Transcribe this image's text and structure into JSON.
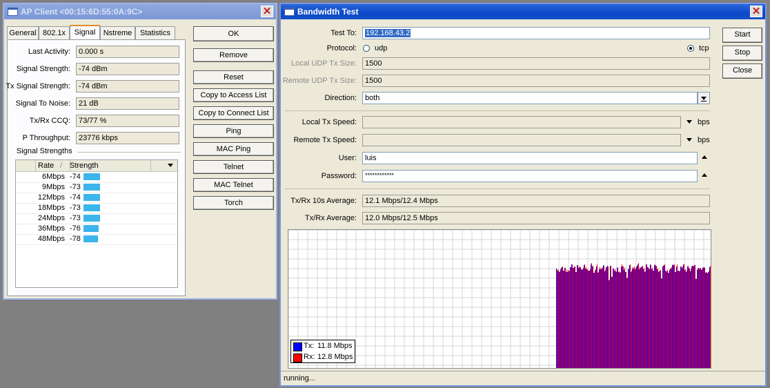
{
  "ap_client": {
    "title": "AP Client <00:15:6D:55:0A:9C>",
    "tabs": [
      "General",
      "802.1x",
      "Signal",
      "Nstreme",
      "Statistics"
    ],
    "active_tab": "Signal",
    "fields": [
      {
        "label": "Last Activity:",
        "value": "0.000 s"
      },
      {
        "label": "Signal Strength:",
        "value": "-74 dBm"
      },
      {
        "label": "Tx Signal Strength:",
        "value": "-74 dBm"
      },
      {
        "label": "Signal To Noise:",
        "value": "21 dB"
      },
      {
        "label": "Tx/Rx CCQ:",
        "value": "73/77 %"
      },
      {
        "label": "P Throughput:",
        "value": "23776 kbps"
      }
    ],
    "group_label": "Signal Strengths",
    "table": {
      "columns": [
        "Rate",
        "Strength"
      ],
      "sort_indicator": "/",
      "rows": [
        {
          "rate": "6Mbps",
          "strength": "-74",
          "bar_level": 0.74
        },
        {
          "rate": "9Mbps",
          "strength": "-73",
          "bar_level": 0.75
        },
        {
          "rate": "12Mbps",
          "strength": "-74",
          "bar_level": 0.74
        },
        {
          "rate": "18Mbps",
          "strength": "-73",
          "bar_level": 0.75
        },
        {
          "rate": "24Mbps",
          "strength": "-73",
          "bar_level": 0.75
        },
        {
          "rate": "36Mbps",
          "strength": "-76",
          "bar_level": 0.7
        },
        {
          "rate": "48Mbps",
          "strength": "-78",
          "bar_level": 0.65
        }
      ]
    },
    "buttons": [
      "OK",
      "Remove",
      "Reset",
      "Copy to Access List",
      "Copy to Connect List",
      "Ping",
      "MAC Ping",
      "Telnet",
      "MAC Telnet",
      "Torch"
    ]
  },
  "bandwidth_test": {
    "title": "Bandwidth Test",
    "buttons": {
      "start": "Start",
      "stop": "Stop",
      "close": "Close"
    },
    "test_to": {
      "label": "Test To:",
      "value": "192.168.43.2"
    },
    "protocol": {
      "label": "Protocol:",
      "options": [
        "udp",
        "tcp"
      ],
      "selected": "tcp"
    },
    "local_udp": {
      "label": "Local UDP Tx Size:",
      "value": "1500"
    },
    "remote_udp": {
      "label": "Remote UDP Tx Size:",
      "value": "1500"
    },
    "direction": {
      "label": "Direction:",
      "value": "both"
    },
    "local_tx_speed": {
      "label": "Local Tx Speed:",
      "value": "",
      "unit": "bps"
    },
    "remote_tx_speed": {
      "label": "Remote Tx Speed:",
      "value": "",
      "unit": "bps"
    },
    "user": {
      "label": "User:",
      "value": "luis"
    },
    "password": {
      "label": "Password:",
      "value": "************"
    },
    "avg10": {
      "label": "Tx/Rx 10s Average:",
      "value": "12.1 Mbps/12.4 Mbps"
    },
    "avg": {
      "label": "Tx/Rx Average:",
      "value": "12.0 Mbps/12.5 Mbps"
    },
    "status": "running...",
    "colors": {
      "tx": "#0000ff",
      "rx": "#ff0000"
    }
  },
  "chart_data": {
    "type": "bar",
    "legend_position": "bottom-left",
    "grid": true,
    "series": [
      {
        "name": "Tx:",
        "label_value": "11.8 Mbps",
        "color": "#0000ff"
      },
      {
        "name": "Rx:",
        "label_value": "12.8 Mbps",
        "color": "#ff0000"
      }
    ],
    "note": ""
  }
}
